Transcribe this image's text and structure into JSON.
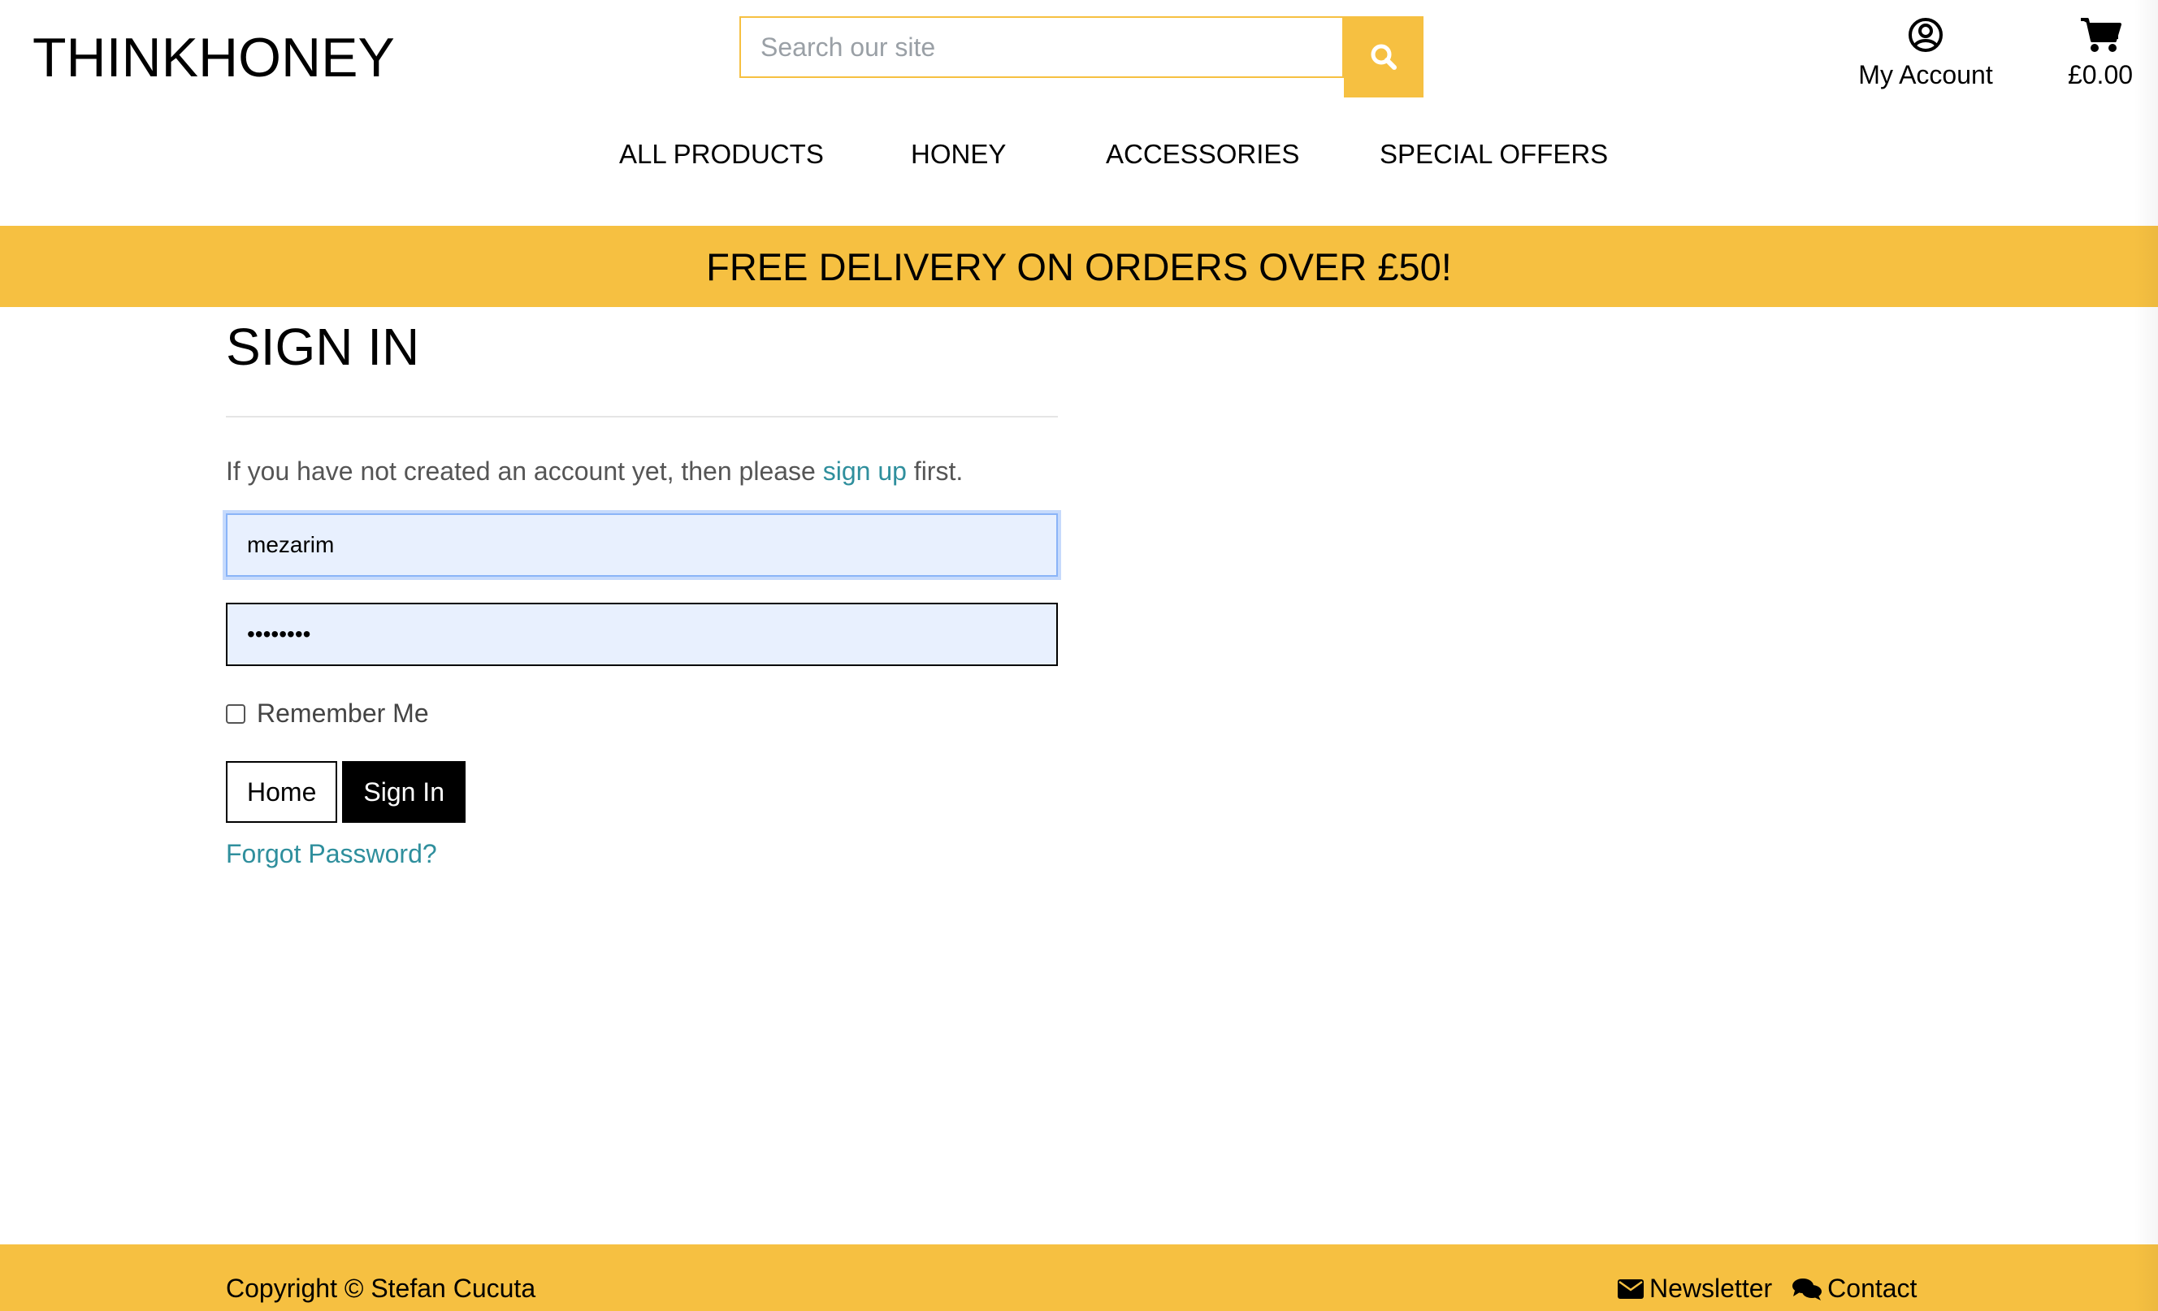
{
  "header": {
    "logo": "THINKHONEY",
    "search_placeholder": "Search our site",
    "search_icon": "search-icon",
    "account_label": "My Account",
    "account_icon": "user-circle-icon",
    "cart_total": "£0.00",
    "cart_icon": "shopping-cart-icon"
  },
  "nav": {
    "items": [
      {
        "label": "ALL PRODUCTS"
      },
      {
        "label": "HONEY"
      },
      {
        "label": "ACCESSORIES"
      },
      {
        "label": "SPECIAL OFFERS"
      }
    ]
  },
  "banner": {
    "text": "FREE DELIVERY ON ORDERS OVER £50!"
  },
  "signin": {
    "title": "SIGN IN",
    "intro_before": "If you have not created an account yet, then please ",
    "intro_link": "sign up",
    "intro_after": " first.",
    "username_value": "mezarim",
    "password_value": "••••••••",
    "remember_label": "Remember Me",
    "remember_checked": false,
    "home_button": "Home",
    "signin_button": "Sign In",
    "forgot_link": "Forgot Password?"
  },
  "footer": {
    "copyright": "Copyright © Stefan Cucuta",
    "newsletter": "Newsletter",
    "newsletter_icon": "envelope-icon",
    "contact": "Contact",
    "contact_icon": "comments-icon"
  },
  "colors": {
    "accent": "#f6c041",
    "link": "#2f8f9d",
    "autofill_bg": "#e8f0fe"
  }
}
